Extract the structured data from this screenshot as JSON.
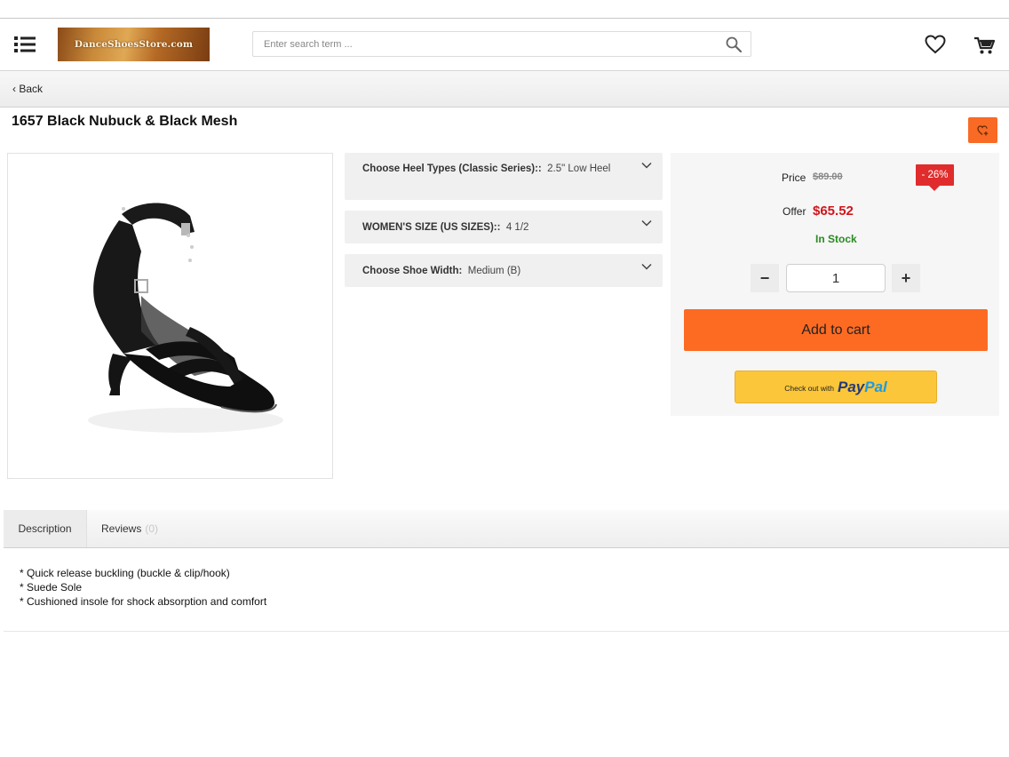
{
  "header": {
    "logo_text": "DanceShoesStore.com",
    "search_placeholder": "Enter search term ..."
  },
  "nav": {
    "back_label": "Back"
  },
  "product": {
    "title": "1657 Black Nubuck & Black Mesh",
    "options": [
      {
        "label": "Choose Heel Types (Classic Series)::",
        "value": "2.5\" Low Heel"
      },
      {
        "label": "WOMEN'S SIZE (US SIZES)::",
        "value": "4 1/2"
      },
      {
        "label": "Choose Shoe Width:",
        "value": "Medium (B)"
      }
    ]
  },
  "buybox": {
    "price_label": "Price",
    "old_price": "$89.00",
    "discount": "- 26%",
    "offer_label": "Offer",
    "offer_price": "$65.52",
    "stock": "In Stock",
    "quantity": "1",
    "minus": "−",
    "plus": "+",
    "add_to_cart": "Add to cart",
    "paypal_prefix": "Check out with",
    "paypal_pay": "Pay",
    "paypal_pal": "Pal"
  },
  "tabs": {
    "description": "Description",
    "reviews": "Reviews",
    "reviews_count": "(0)"
  },
  "description": {
    "lines": [
      "* Quick release buckling (buckle & clip/hook)",
      "* Suede Sole",
      "* Cushioned insole for shock absorption and comfort"
    ]
  },
  "colors": {
    "accent": "#fd6b23",
    "offer_price": "#d0161d",
    "in_stock": "#2a8a23",
    "discount_badge": "#e02c2c",
    "paypal_button": "#fbc63a"
  },
  "icons": [
    "menu-icon",
    "search-icon",
    "heart-icon",
    "cart-icon",
    "chevron-down-icon",
    "wishlist-add-icon"
  ]
}
